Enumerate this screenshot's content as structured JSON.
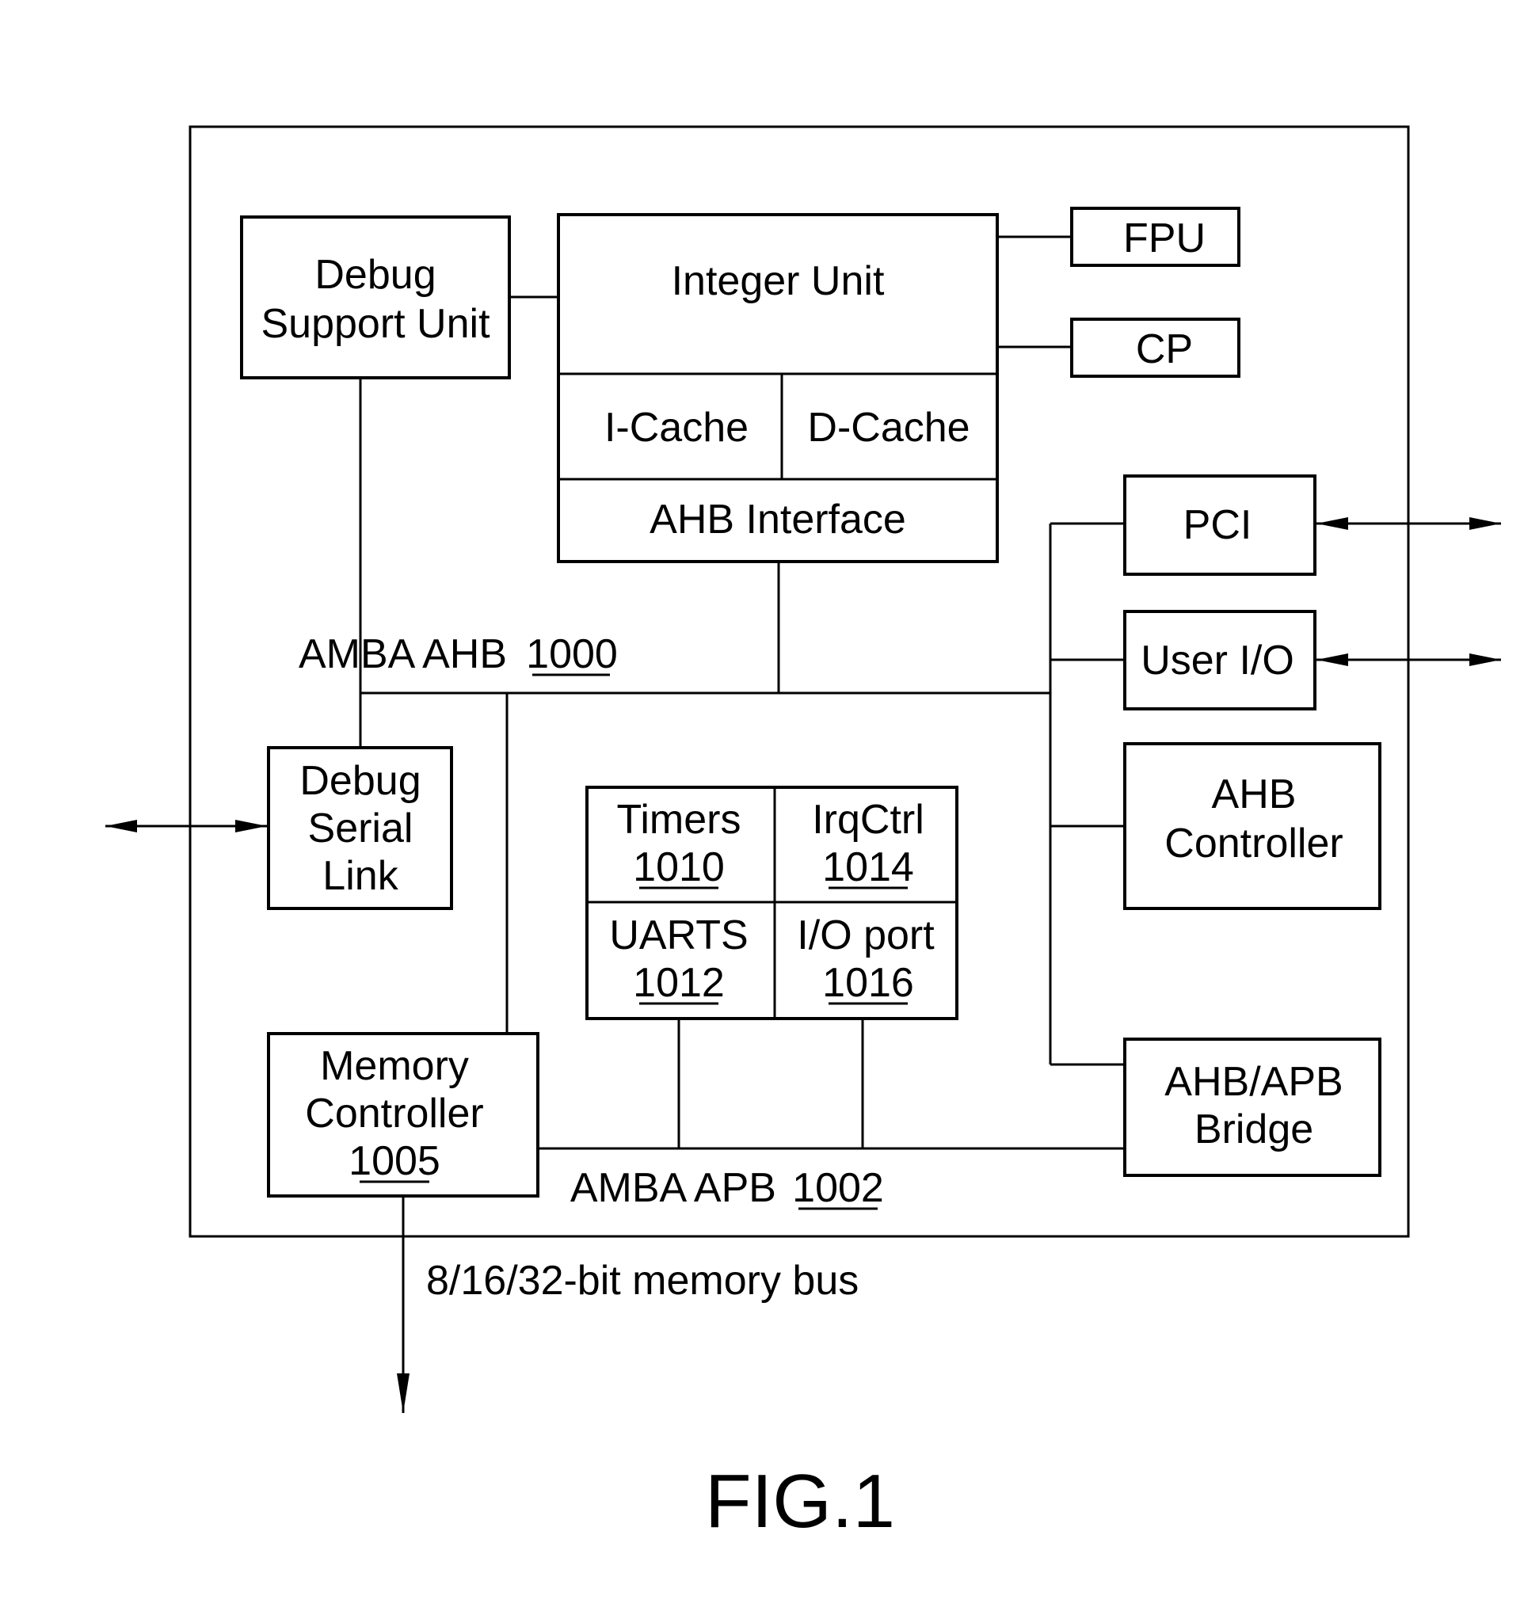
{
  "figure": {
    "caption": "FIG.1",
    "blocks": {
      "debug_support_unit": {
        "line1": "Debug",
        "line2": "Support Unit"
      },
      "integer_unit": {
        "label": "Integer Unit"
      },
      "icache": {
        "label": "I-Cache"
      },
      "dcache": {
        "label": "D-Cache"
      },
      "ahb_interface": {
        "label": "AHB Interface"
      },
      "fpu": {
        "label": "FPU"
      },
      "cp": {
        "label": "CP"
      },
      "pci": {
        "label": "PCI"
      },
      "user_io": {
        "label": "User I/O"
      },
      "ahb_controller": {
        "line1": "AHB",
        "line2": "Controller"
      },
      "ahb_apb_bridge": {
        "line1": "AHB/APB",
        "line2": "Bridge"
      },
      "debug_serial_link": {
        "line1": "Debug",
        "line2": "Serial",
        "line3": "Link"
      },
      "memory_controller": {
        "line1": "Memory",
        "line2": "Controller",
        "ref": "1005"
      },
      "timers": {
        "label": "Timers",
        "ref": "1010"
      },
      "irqctrl": {
        "label": "IrqCtrl",
        "ref": "1014"
      },
      "uarts": {
        "label": "UARTS",
        "ref": "1012"
      },
      "io_port": {
        "label": "I/O port",
        "ref": "1016"
      }
    },
    "buses": {
      "ahb": {
        "label": "AMBA AHB",
        "ref": "1000"
      },
      "apb": {
        "label": "AMBA APB",
        "ref": "1002"
      },
      "memory_bus": {
        "label": "8/16/32-bit memory bus"
      }
    }
  }
}
